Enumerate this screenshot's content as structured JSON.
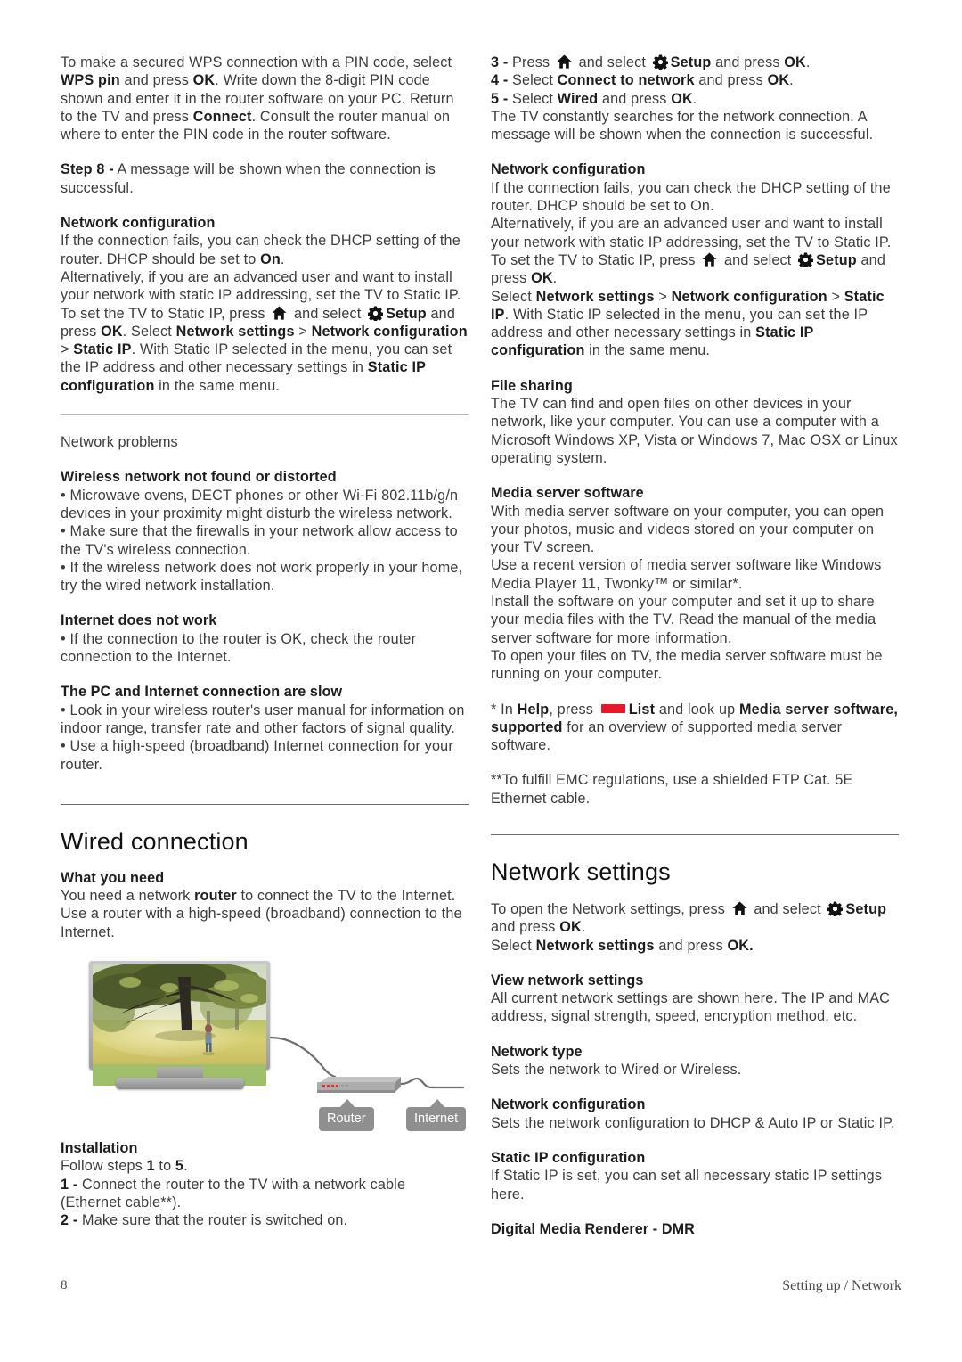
{
  "document": {
    "footer": {
      "page_number": "8",
      "breadcrumb": "Setting up / Network"
    }
  },
  "icons": {
    "home": "home-icon",
    "gear": "gear-icon",
    "red_key": "red-key-icon"
  },
  "left_column": {
    "wps_pin_para": {
      "t1": "To make a secured WPS connection with a PIN code, select ",
      "b1": "WPS pin",
      "t2": " and press ",
      "b2": "OK",
      "t3": ". Write down the 8-digit PIN code shown and enter it in the router software on your PC. Return to the TV and press ",
      "b3": "Connect",
      "t4": ". Consult the router manual on where to enter the PIN code in the router software."
    },
    "step8": {
      "b1": "Step 8 -",
      "t1": " A message will be shown when the connection is successful."
    },
    "network_configuration": {
      "heading": "Network configuration",
      "t1": "If the connection fails, you can check the DHCP setting of the router. DHCP should be set to ",
      "b1": "On",
      "t2": ".",
      "t3": "Alternatively, if you are an advanced user and want to install your network with static IP addressing, set the TV to Static IP. To set the TV to Static IP, press ",
      "t4": " and select ",
      "b2": "Setup",
      "t5": " and press ",
      "b3": "OK",
      "t6": ". Select ",
      "b4": "Network settings",
      "t7": " > ",
      "b5": "Network configuration",
      "t8": " > ",
      "b6": "Static IP",
      "t9": ". With Static IP selected in the menu, you can set the IP address and other necessary settings in ",
      "b7": "Static IP configuration",
      "t10": " in the same menu."
    },
    "network_problems": {
      "heading": "Network problems",
      "wireless_not_found": {
        "heading": "Wireless network not found or distorted",
        "bullets": [
          "Microwave ovens, DECT phones or other Wi-Fi 802.11b/g/n devices in your proximity might disturb the wireless network.",
          "Make sure that the firewalls in your network allow access to the TV's wireless connection.",
          "If the wireless network does not work properly in your home, try the wired network installation."
        ]
      },
      "internet_not_work": {
        "heading": "Internet does not work",
        "bullets": [
          "If the connection to the router is OK, check the router connection to the Internet."
        ]
      },
      "pc_slow": {
        "heading": "The PC and Internet connection are slow",
        "bullets": [
          "Look in your wireless router's user manual for information on indoor range, transfer rate and other factors of signal quality.",
          "Use a high-speed (broadband) Internet connection for your router."
        ]
      }
    },
    "wired_connection": {
      "chapter_title": "Wired connection",
      "what_you_need": {
        "heading": "What you need",
        "t1": "You need a network ",
        "b1": "router",
        "t2": " to connect the TV to the Internet. Use a router with a high-speed (broadband) connection to the Internet."
      },
      "diagram": {
        "router_label": "Router",
        "internet_label": "Internet"
      },
      "installation": {
        "heading": "Installation",
        "t1": "Follow steps ",
        "b1": "1",
        "t2": " to ",
        "b2": "5",
        "t3": ".",
        "steps": [
          {
            "num": "1 -",
            "text": " Connect the router to the TV with a network cable (Ethernet cable**)."
          },
          {
            "num": "2 -",
            "text": " Make sure that the router is switched on."
          }
        ]
      }
    }
  },
  "right_column": {
    "steps": [
      {
        "num": "3 -",
        "t1": " Press ",
        "t2": " and select ",
        "b1": "Setup",
        "t3": " and press ",
        "b2": "OK",
        "t4": "."
      },
      {
        "num": "4 -",
        "t1": " Select ",
        "b1": "Connect to network",
        "t2": " and press ",
        "b2": "OK",
        "t3": "."
      },
      {
        "num": "5 -",
        "t1": " Select ",
        "b1": "Wired",
        "t2": " and press ",
        "b2": "OK",
        "t3": "."
      }
    ],
    "searching_note": "The TV constantly searches for the network connection. A message will be shown when the connection is successful.",
    "network_configuration": {
      "heading": "Network configuration",
      "t1": "If the connection fails, you can check the DHCP setting of the router. DHCP should be set to On.",
      "t2": "Alternatively, if you are an advanced user and want to install your network with static IP addressing, set the TV to Static IP. To set the TV to Static IP, press ",
      "t3": " and select ",
      "b1": "Setup",
      "t4": " and press ",
      "b2": "OK",
      "t5": ".",
      "t6": "Select ",
      "b3": "Network settings",
      "t7": " > ",
      "b4": "Network configuration",
      "t8": " > ",
      "b5": "Static IP",
      "t9": ". With Static IP selected in the menu, you can set the IP address and other necessary settings in ",
      "b6": "Static IP configuration",
      "t10": " in the same menu."
    },
    "file_sharing": {
      "heading": "File sharing",
      "body": "The TV can find and open files on other devices in your network, like your computer. You can use a computer with a Microsoft Windows XP, Vista or Windows 7, Mac OSX or Linux operating system."
    },
    "media_server_software": {
      "heading": "Media server software",
      "p1": "With media server software on your computer, you can open your photos, music and videos stored on your computer on your TV screen.",
      "p2": "Use a recent version of media server software like Windows Media Player 11, Twonky™ or similar*.",
      "p3": "Install the software on your computer and set it up to share your media files with the TV. Read the manual of the media server software for more information.",
      "p4": "To open your files on TV, the media server software must be running on your computer."
    },
    "footnote_star": {
      "t1": "* In ",
      "b1": "Help",
      "t2": ", press ",
      "b2": "List",
      "t3": " and look up ",
      "b3": "Media server software, supported",
      "t4": " for an overview of supported media server software."
    },
    "footnote_dstar": "**To fulfill EMC regulations, use a shielded FTP Cat. 5E Ethernet cable.",
    "network_settings": {
      "chapter_title": "Network settings",
      "intro": {
        "t1": "To open the Network settings, press ",
        "t2": " and select ",
        "b1": "Setup",
        "t3": " and press ",
        "b2": "OK",
        "t4": ".",
        "t5": "Select ",
        "b3": "Network settings",
        "t6": " and press ",
        "b4": "OK."
      },
      "sections": [
        {
          "heading": "View network settings",
          "body": "All current network settings are shown here. The IP and MAC address, signal strength, speed, encryption method, etc."
        },
        {
          "heading": "Network type",
          "body": "Sets the network to Wired or Wireless."
        },
        {
          "heading": "Network configuration",
          "body": "Sets the network configuration to DHCP & Auto IP or Static IP."
        },
        {
          "heading": "Static IP configuration",
          "body": "If Static IP is set, you can set all necessary static IP settings here."
        },
        {
          "heading": "Digital Media Renderer - DMR",
          "body": ""
        }
      ]
    }
  },
  "colors": {
    "red_key": "#e8182a",
    "body_text": "#3c3c3c",
    "heading_text": "#1d1d1d",
    "rule": "#b9b9b9"
  }
}
